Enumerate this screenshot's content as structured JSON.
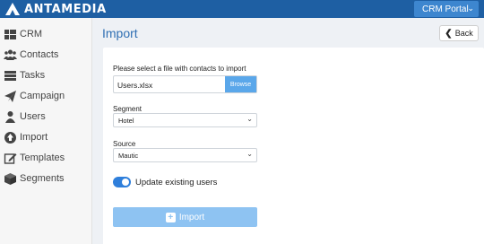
{
  "topbar": {
    "brand": "ANTAMEDIA",
    "portal_button": "CRM Portal"
  },
  "sidebar": {
    "items": [
      {
        "label": "CRM",
        "icon": "grid-icon"
      },
      {
        "label": "Contacts",
        "icon": "users-group-icon"
      },
      {
        "label": "Tasks",
        "icon": "tasks-icon"
      },
      {
        "label": "Campaign",
        "icon": "paper-plane-icon"
      },
      {
        "label": "Users",
        "icon": "user-icon"
      },
      {
        "label": "Import",
        "icon": "upload-circle-icon"
      },
      {
        "label": "Templates",
        "icon": "edit-icon"
      },
      {
        "label": "Segments",
        "icon": "cube-icon"
      }
    ]
  },
  "page": {
    "title": "Import",
    "back_label": "Back"
  },
  "form": {
    "file_label": "Please select a file with contacts to import",
    "file_value": "Users.xlsx",
    "browse_label": "Browse",
    "segment_label": "Segment",
    "segment_value": "Hotel",
    "source_label": "Source",
    "source_value": "Mautic",
    "toggle_label": "Update existing users",
    "toggle_on": true,
    "import_label": "Import"
  },
  "colors": {
    "topbar": "#1e5fa3",
    "accent": "#2f6fb3",
    "button_light": "#8ec3f2",
    "browse": "#5aa7ea"
  }
}
